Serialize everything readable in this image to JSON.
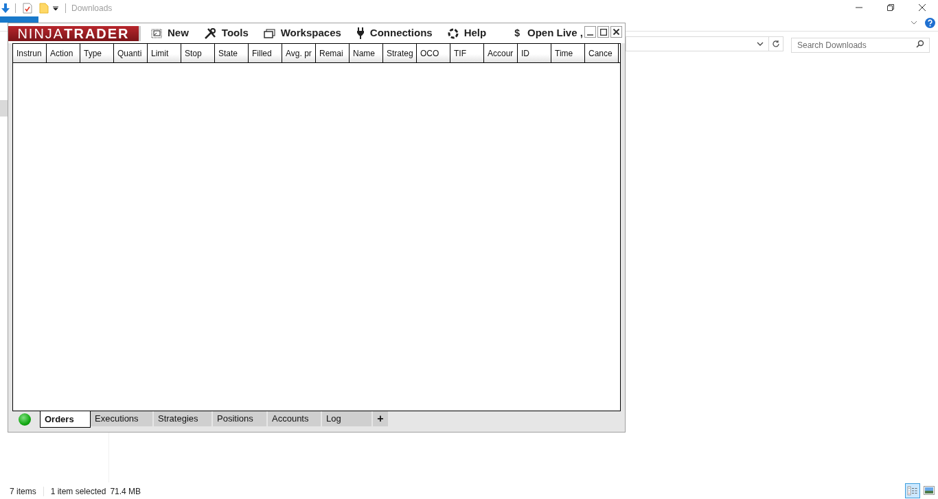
{
  "explorer": {
    "title": "Downloads",
    "search": {
      "placeholder": "Search Downloads"
    },
    "status": {
      "items": "7 items",
      "selection": "1 item selected",
      "size": "71.4 MB"
    },
    "view_buttons": [
      {
        "kind": "details",
        "selected": true
      },
      {
        "kind": "thumbnails",
        "selected": false
      }
    ]
  },
  "ninjatrader": {
    "logo": {
      "first": "NINJA",
      "second": "TRADER"
    },
    "menu": [
      {
        "kind": "new",
        "label": "New"
      },
      {
        "kind": "tools",
        "label": "Tools"
      },
      {
        "kind": "workspaces",
        "label": "Workspaces"
      },
      {
        "kind": "connections",
        "label": "Connections"
      },
      {
        "kind": "help",
        "label": "Help"
      },
      {
        "kind": "dollar",
        "label": "$"
      },
      {
        "kind": "text",
        "label": "Open Live ,"
      }
    ],
    "columns": [
      "Instrun",
      "Action",
      "Type",
      "Quanti",
      "Limit",
      "Stop",
      "State",
      "Filled",
      "Avg. pr",
      "Remai",
      "Name",
      "Strateg",
      "OCO",
      "TIF",
      "Accour",
      "ID",
      "Time",
      "Cance"
    ],
    "connected": true,
    "tabs": [
      {
        "label": "Orders",
        "selected": true
      },
      {
        "label": "Executions",
        "selected": false
      },
      {
        "label": "Strategies",
        "selected": false
      },
      {
        "label": "Positions",
        "selected": false
      },
      {
        "label": "Accounts",
        "selected": false
      },
      {
        "label": "Log",
        "selected": false
      },
      {
        "label": "+",
        "selected": false
      }
    ]
  }
}
